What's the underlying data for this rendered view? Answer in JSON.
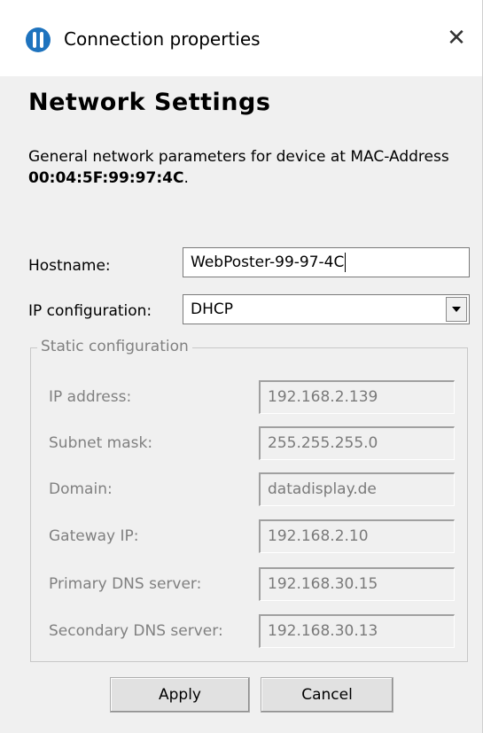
{
  "window": {
    "title": "Connection properties",
    "close_glyph": "✕"
  },
  "header": {
    "heading": "Network Settings",
    "description_prefix": "General network parameters for device at MAC-Address ",
    "mac_address": "00:04:5F:99:97:4C",
    "description_suffix": "."
  },
  "form": {
    "hostname_label": "Hostname:",
    "hostname_value": "WebPoster-99-97-4C",
    "ip_config_label": "IP configuration:",
    "ip_config_value": "DHCP"
  },
  "static_config": {
    "legend": "Static configuration",
    "fields": [
      {
        "label": "IP address:",
        "value": "192.168.2.139"
      },
      {
        "label": "Subnet mask:",
        "value": "255.255.255.0"
      },
      {
        "label": "Domain:",
        "value": "datadisplay.de"
      },
      {
        "label": "Gateway IP:",
        "value": "192.168.2.10"
      },
      {
        "label": "Primary DNS server:",
        "value": "192.168.30.15"
      },
      {
        "label": "Secondary DNS server:",
        "value": "192.168.30.13"
      }
    ]
  },
  "buttons": {
    "apply": "Apply",
    "cancel": "Cancel"
  },
  "icons": {
    "app": "app-logo-icon",
    "close": "close-icon",
    "dropdown": "chevron-down-icon"
  },
  "colors": {
    "icon_blue": "#1e73be",
    "disabled_text": "#808080"
  }
}
